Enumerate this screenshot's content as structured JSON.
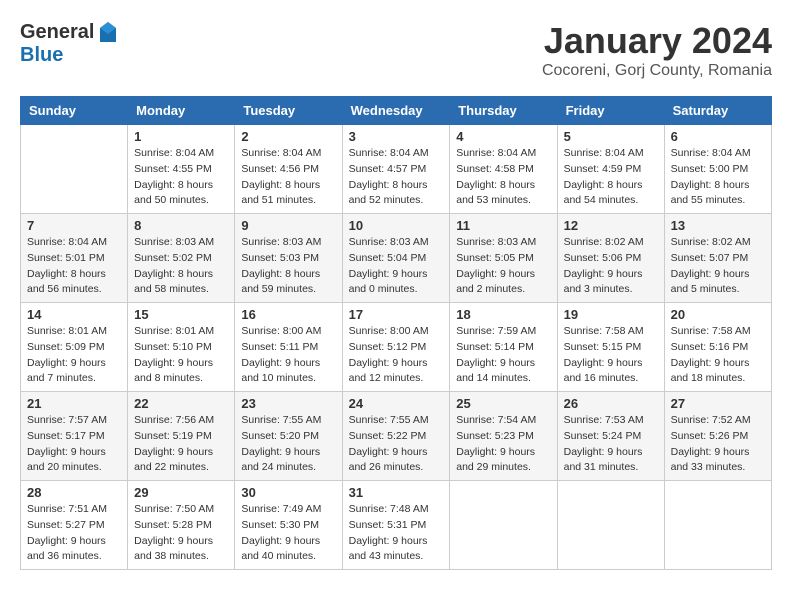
{
  "header": {
    "logo_general": "General",
    "logo_blue": "Blue",
    "month_title": "January 2024",
    "location": "Cocoreni, Gorj County, Romania"
  },
  "weekdays": [
    "Sunday",
    "Monday",
    "Tuesday",
    "Wednesday",
    "Thursday",
    "Friday",
    "Saturday"
  ],
  "weeks": [
    [
      {
        "day": "",
        "info": ""
      },
      {
        "day": "1",
        "info": "Sunrise: 8:04 AM\nSunset: 4:55 PM\nDaylight: 8 hours\nand 50 minutes."
      },
      {
        "day": "2",
        "info": "Sunrise: 8:04 AM\nSunset: 4:56 PM\nDaylight: 8 hours\nand 51 minutes."
      },
      {
        "day": "3",
        "info": "Sunrise: 8:04 AM\nSunset: 4:57 PM\nDaylight: 8 hours\nand 52 minutes."
      },
      {
        "day": "4",
        "info": "Sunrise: 8:04 AM\nSunset: 4:58 PM\nDaylight: 8 hours\nand 53 minutes."
      },
      {
        "day": "5",
        "info": "Sunrise: 8:04 AM\nSunset: 4:59 PM\nDaylight: 8 hours\nand 54 minutes."
      },
      {
        "day": "6",
        "info": "Sunrise: 8:04 AM\nSunset: 5:00 PM\nDaylight: 8 hours\nand 55 minutes."
      }
    ],
    [
      {
        "day": "7",
        "info": "Sunrise: 8:04 AM\nSunset: 5:01 PM\nDaylight: 8 hours\nand 56 minutes."
      },
      {
        "day": "8",
        "info": "Sunrise: 8:03 AM\nSunset: 5:02 PM\nDaylight: 8 hours\nand 58 minutes."
      },
      {
        "day": "9",
        "info": "Sunrise: 8:03 AM\nSunset: 5:03 PM\nDaylight: 8 hours\nand 59 minutes."
      },
      {
        "day": "10",
        "info": "Sunrise: 8:03 AM\nSunset: 5:04 PM\nDaylight: 9 hours\nand 0 minutes."
      },
      {
        "day": "11",
        "info": "Sunrise: 8:03 AM\nSunset: 5:05 PM\nDaylight: 9 hours\nand 2 minutes."
      },
      {
        "day": "12",
        "info": "Sunrise: 8:02 AM\nSunset: 5:06 PM\nDaylight: 9 hours\nand 3 minutes."
      },
      {
        "day": "13",
        "info": "Sunrise: 8:02 AM\nSunset: 5:07 PM\nDaylight: 9 hours\nand 5 minutes."
      }
    ],
    [
      {
        "day": "14",
        "info": "Sunrise: 8:01 AM\nSunset: 5:09 PM\nDaylight: 9 hours\nand 7 minutes."
      },
      {
        "day": "15",
        "info": "Sunrise: 8:01 AM\nSunset: 5:10 PM\nDaylight: 9 hours\nand 8 minutes."
      },
      {
        "day": "16",
        "info": "Sunrise: 8:00 AM\nSunset: 5:11 PM\nDaylight: 9 hours\nand 10 minutes."
      },
      {
        "day": "17",
        "info": "Sunrise: 8:00 AM\nSunset: 5:12 PM\nDaylight: 9 hours\nand 12 minutes."
      },
      {
        "day": "18",
        "info": "Sunrise: 7:59 AM\nSunset: 5:14 PM\nDaylight: 9 hours\nand 14 minutes."
      },
      {
        "day": "19",
        "info": "Sunrise: 7:58 AM\nSunset: 5:15 PM\nDaylight: 9 hours\nand 16 minutes."
      },
      {
        "day": "20",
        "info": "Sunrise: 7:58 AM\nSunset: 5:16 PM\nDaylight: 9 hours\nand 18 minutes."
      }
    ],
    [
      {
        "day": "21",
        "info": "Sunrise: 7:57 AM\nSunset: 5:17 PM\nDaylight: 9 hours\nand 20 minutes."
      },
      {
        "day": "22",
        "info": "Sunrise: 7:56 AM\nSunset: 5:19 PM\nDaylight: 9 hours\nand 22 minutes."
      },
      {
        "day": "23",
        "info": "Sunrise: 7:55 AM\nSunset: 5:20 PM\nDaylight: 9 hours\nand 24 minutes."
      },
      {
        "day": "24",
        "info": "Sunrise: 7:55 AM\nSunset: 5:22 PM\nDaylight: 9 hours\nand 26 minutes."
      },
      {
        "day": "25",
        "info": "Sunrise: 7:54 AM\nSunset: 5:23 PM\nDaylight: 9 hours\nand 29 minutes."
      },
      {
        "day": "26",
        "info": "Sunrise: 7:53 AM\nSunset: 5:24 PM\nDaylight: 9 hours\nand 31 minutes."
      },
      {
        "day": "27",
        "info": "Sunrise: 7:52 AM\nSunset: 5:26 PM\nDaylight: 9 hours\nand 33 minutes."
      }
    ],
    [
      {
        "day": "28",
        "info": "Sunrise: 7:51 AM\nSunset: 5:27 PM\nDaylight: 9 hours\nand 36 minutes."
      },
      {
        "day": "29",
        "info": "Sunrise: 7:50 AM\nSunset: 5:28 PM\nDaylight: 9 hours\nand 38 minutes."
      },
      {
        "day": "30",
        "info": "Sunrise: 7:49 AM\nSunset: 5:30 PM\nDaylight: 9 hours\nand 40 minutes."
      },
      {
        "day": "31",
        "info": "Sunrise: 7:48 AM\nSunset: 5:31 PM\nDaylight: 9 hours\nand 43 minutes."
      },
      {
        "day": "",
        "info": ""
      },
      {
        "day": "",
        "info": ""
      },
      {
        "day": "",
        "info": ""
      }
    ]
  ]
}
